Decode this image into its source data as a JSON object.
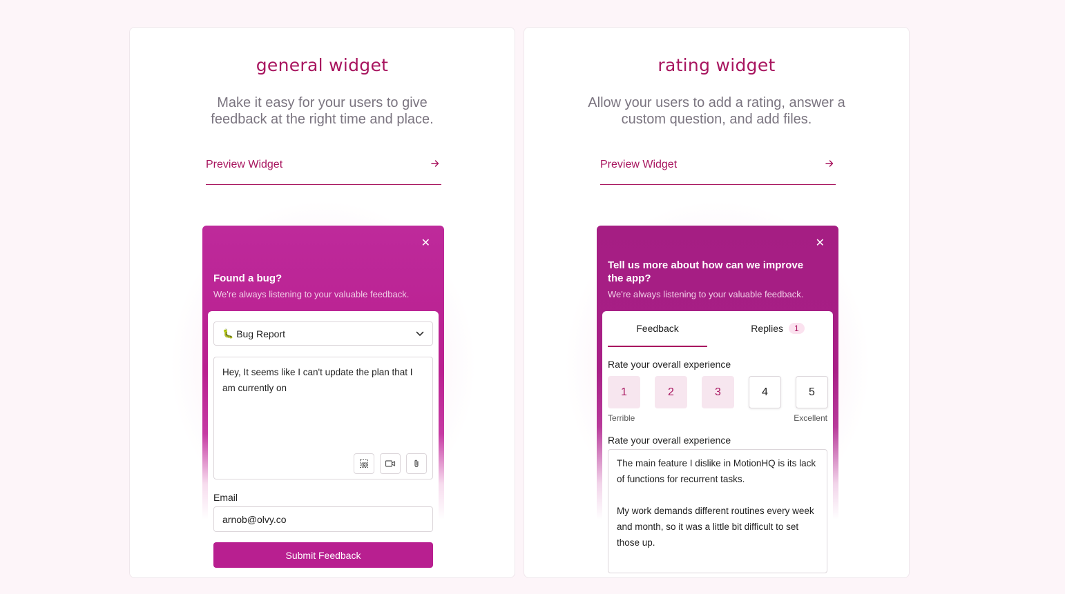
{
  "general": {
    "title": "general widget",
    "description": "Make it easy for your users to give feedback at the right time and place.",
    "preview_label": "Preview Widget",
    "widget": {
      "close": "✕",
      "title": "Found a bug?",
      "subtitle": "We're always listening to your valuable feedback.",
      "category_icon": "🐛",
      "category_value": "Bug Report",
      "message": "Hey, It seems like I can't update the plan that I am currently on",
      "email_label": "Email",
      "email_value": "arnob@olvy.co",
      "submit_label": "Submit Feedback"
    }
  },
  "rating": {
    "title": "rating widget",
    "description": "Allow your users to add a rating, answer a custom question, and add files.",
    "preview_label": "Preview Widget",
    "widget": {
      "close": "✕",
      "title": "Tell us more about how can we improve the app?",
      "subtitle": "We're always listening to your valuable feedback.",
      "tabs": {
        "feedback": "Feedback",
        "replies": "Replies",
        "replies_count": "1"
      },
      "rate_label": "Rate your overall experience",
      "scale": [
        "1",
        "2",
        "3",
        "4",
        "5"
      ],
      "selected_rating": 3,
      "scale_low": "Terrible",
      "scale_high": "Excellent",
      "question_label": "Rate your overall experience",
      "answer_p1": "The main feature I dislike in MotionHQ is its lack of functions for recurrent tasks.",
      "answer_p2": "My work demands different routines every week and month, so it was a little bit difficult to set those up."
    }
  },
  "colors": {
    "accent": "#a8155f",
    "widget_general": "#be2a9b",
    "widget_rating": "#a51e83",
    "submit": "#b81f90"
  }
}
